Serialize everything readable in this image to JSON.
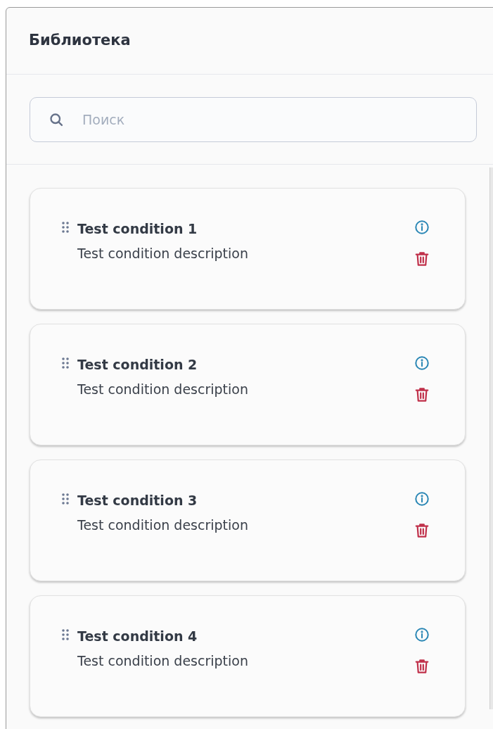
{
  "panel": {
    "title": "Библиотека"
  },
  "search": {
    "placeholder": "Поиск"
  },
  "conditions": [
    {
      "title": "Test condition 1",
      "description": "Test condition description"
    },
    {
      "title": "Test condition 2",
      "description": "Test condition description"
    },
    {
      "title": "Test condition 3",
      "description": "Test condition description"
    },
    {
      "title": "Test condition 4",
      "description": "Test condition description"
    }
  ]
}
